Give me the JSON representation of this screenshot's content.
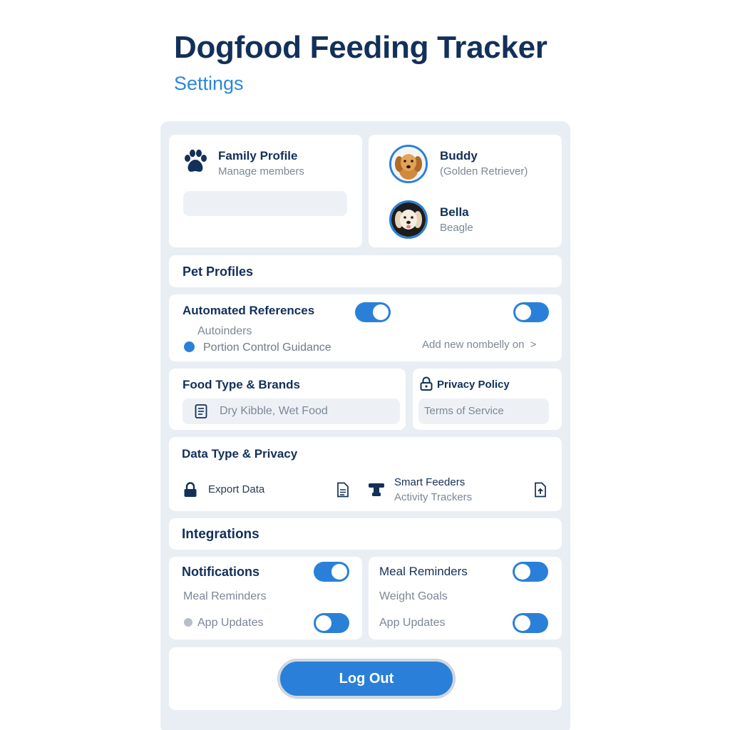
{
  "header": {
    "title": "Dogfood Feeding Tracker",
    "subtitle": "Settings"
  },
  "family_profile": {
    "title": "Family Profile",
    "subtitle": "Manage members",
    "icon": "paw-icon"
  },
  "pets": [
    {
      "name": "Buddy",
      "breed": "(Golden Retriever)"
    },
    {
      "name": "Bella",
      "breed": "Beagle"
    }
  ],
  "pet_profiles": {
    "title": "Pet Profiles"
  },
  "automated": {
    "title": "Automated References",
    "toggle_left_on": true,
    "toggle_right_on": false,
    "sub1": "Autoinders",
    "sub2": "Portion Control Guidance",
    "link": "Add new nombelly on",
    "link_arrow": ">"
  },
  "food_type": {
    "title": "Food Type & Brands",
    "value": "Dry Kibble, Wet Food"
  },
  "privacy": {
    "title": "Privacy Policy",
    "terms": "Terms of Service"
  },
  "data_privacy": {
    "title": "Data Type & Privacy",
    "export": "Export Data",
    "smart_feeders": "Smart Feeders",
    "activity_trackers": "Activity Trackers"
  },
  "integrations": {
    "title": "Integrations"
  },
  "notifications": {
    "title": "Notifications",
    "toggle_on": true,
    "item1": "Meal Reminders",
    "item2": "App Updates",
    "item2_toggle_on": false
  },
  "meal_reminders": {
    "title": "Meal Reminders",
    "toggle_on": false,
    "item1": "Weight Goals",
    "item2": "App Updates",
    "item2_toggle_on": false
  },
  "logout": {
    "label": "Log Out"
  },
  "colors": {
    "accent": "#2a80d8",
    "title": "#12305a",
    "subtitle": "#2a87db",
    "panel": "#e9eef5"
  }
}
